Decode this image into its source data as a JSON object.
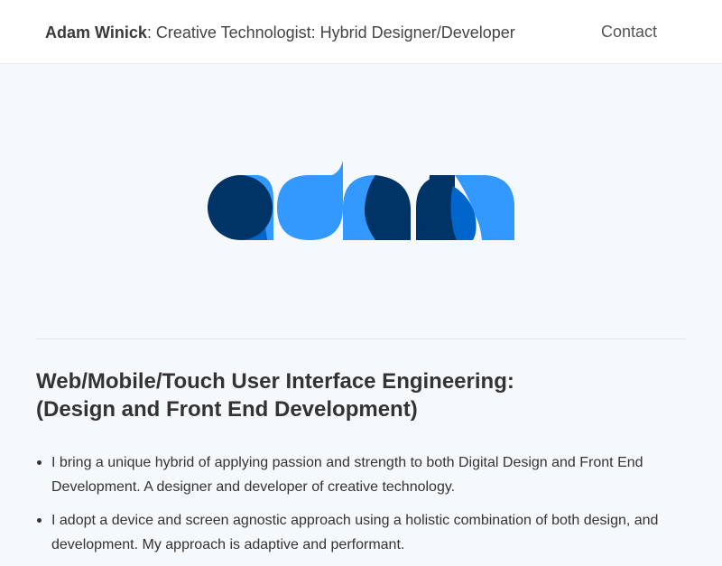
{
  "header": {
    "name": "Adam Winick",
    "tagline": ": Creative Technologist: Hybrid Designer/Developer",
    "nav_contact": "Contact"
  },
  "logo": {
    "alt": "adam",
    "colors": {
      "dark": "#003366",
      "mid": "#0066cc",
      "light": "#3399ff"
    }
  },
  "main": {
    "heading_line1": "Web/Mobile/Touch User Interface Engineering:",
    "heading_line2": "(Design and Front End Development)",
    "bullets": [
      "I bring a unique hybrid of applying passion and strength to both Digital Design and Front End Development. A designer and developer of creative technology.",
      "I adopt a device and screen agnostic approach using a holistic combination of both design, and development. My approach is adaptive and performant."
    ]
  }
}
